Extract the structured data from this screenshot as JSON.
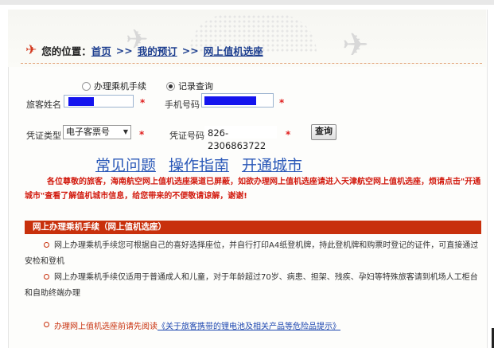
{
  "breadcrumb": {
    "label": "您的位置：",
    "home": "首页",
    "separator": ">>",
    "my_booking": "我的预订",
    "current": "网上值机选座"
  },
  "form": {
    "radio_checkin": "办理乘机手续",
    "radio_record": "记录查询",
    "name_label": "旅客姓名",
    "phone_label": "手机号码",
    "doc_type_label": "凭证类型",
    "doc_type_value": "电子客票号",
    "doc_no_label": "凭证号码",
    "doc_no_value": "826-2306863722",
    "required_mark": "*",
    "query_button": "查询"
  },
  "help_links": [
    "常见问题",
    "操作指南",
    "开通城市"
  ],
  "notice": "各位尊敬的旅客，海南航空网上值机选座渠道已屏蔽，如欲办理网上值机选座请进入天津航空网上值机选座，烦请点击\"开通城市\"查看了解值机城市信息，给您带来的不便敬请谅解，谢谢!",
  "section": {
    "title": "网上办理乘机手续（网上值机选座）",
    "items": [
      "网上办理乘机手续您可根据自己的喜好选择座位，并自行打印A4纸登机牌，持此登机牌和购票时登记的证件，可直接通过安检和登机",
      "网上办理乘机手续仅适用于普通成人和儿童，对于年龄超过70岁、病患、担架、残疾、孕妇等特殊旅客请到机场人工柜台和自助终端办理"
    ],
    "read_prefix": "办理网上值机选座前请先阅读",
    "read_link": "《关于旅客携带的锂电池及相关产品等危险品提示》"
  }
}
